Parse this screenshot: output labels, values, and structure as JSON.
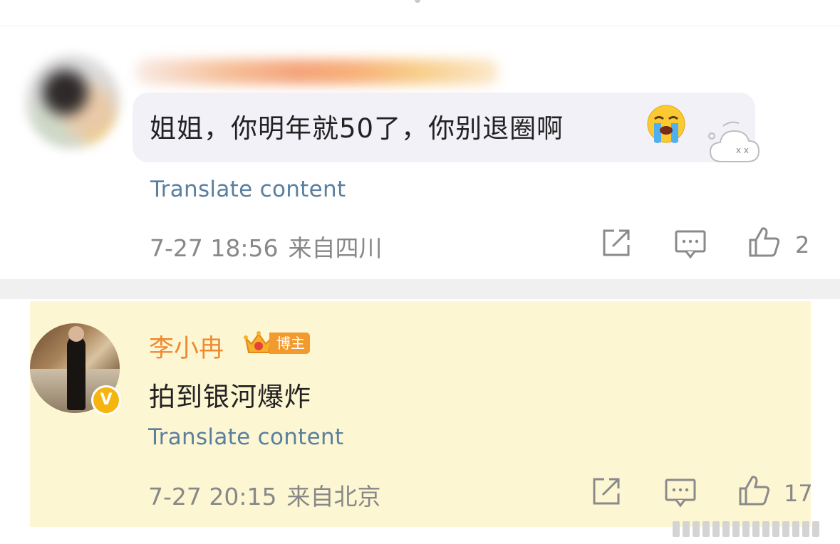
{
  "comment1": {
    "text": "姐姐，你明年就50了，你别退圈啊",
    "emoji": "loudly-crying-face",
    "translate_label": "Translate content",
    "date": "7-27 18:56",
    "location": "来自四川",
    "like_count": "2"
  },
  "comment2": {
    "username": "李小冉",
    "badge_label": "博主",
    "verified_mark": "V",
    "text": "拍到银河爆炸",
    "translate_label": "Translate content",
    "date": "7-27 20:15",
    "location": "来自北京",
    "like_count": "17"
  },
  "colors": {
    "link": "#5a7f9f",
    "username": "#ee8a2f",
    "highlight_bg": "#fdf6d3",
    "bubble_bg": "#f3f1f8",
    "verified_badge": "#f6b40e"
  },
  "icons": [
    "share-icon",
    "comment-icon",
    "like-icon",
    "crown-icon",
    "cry-emoji-icon"
  ]
}
